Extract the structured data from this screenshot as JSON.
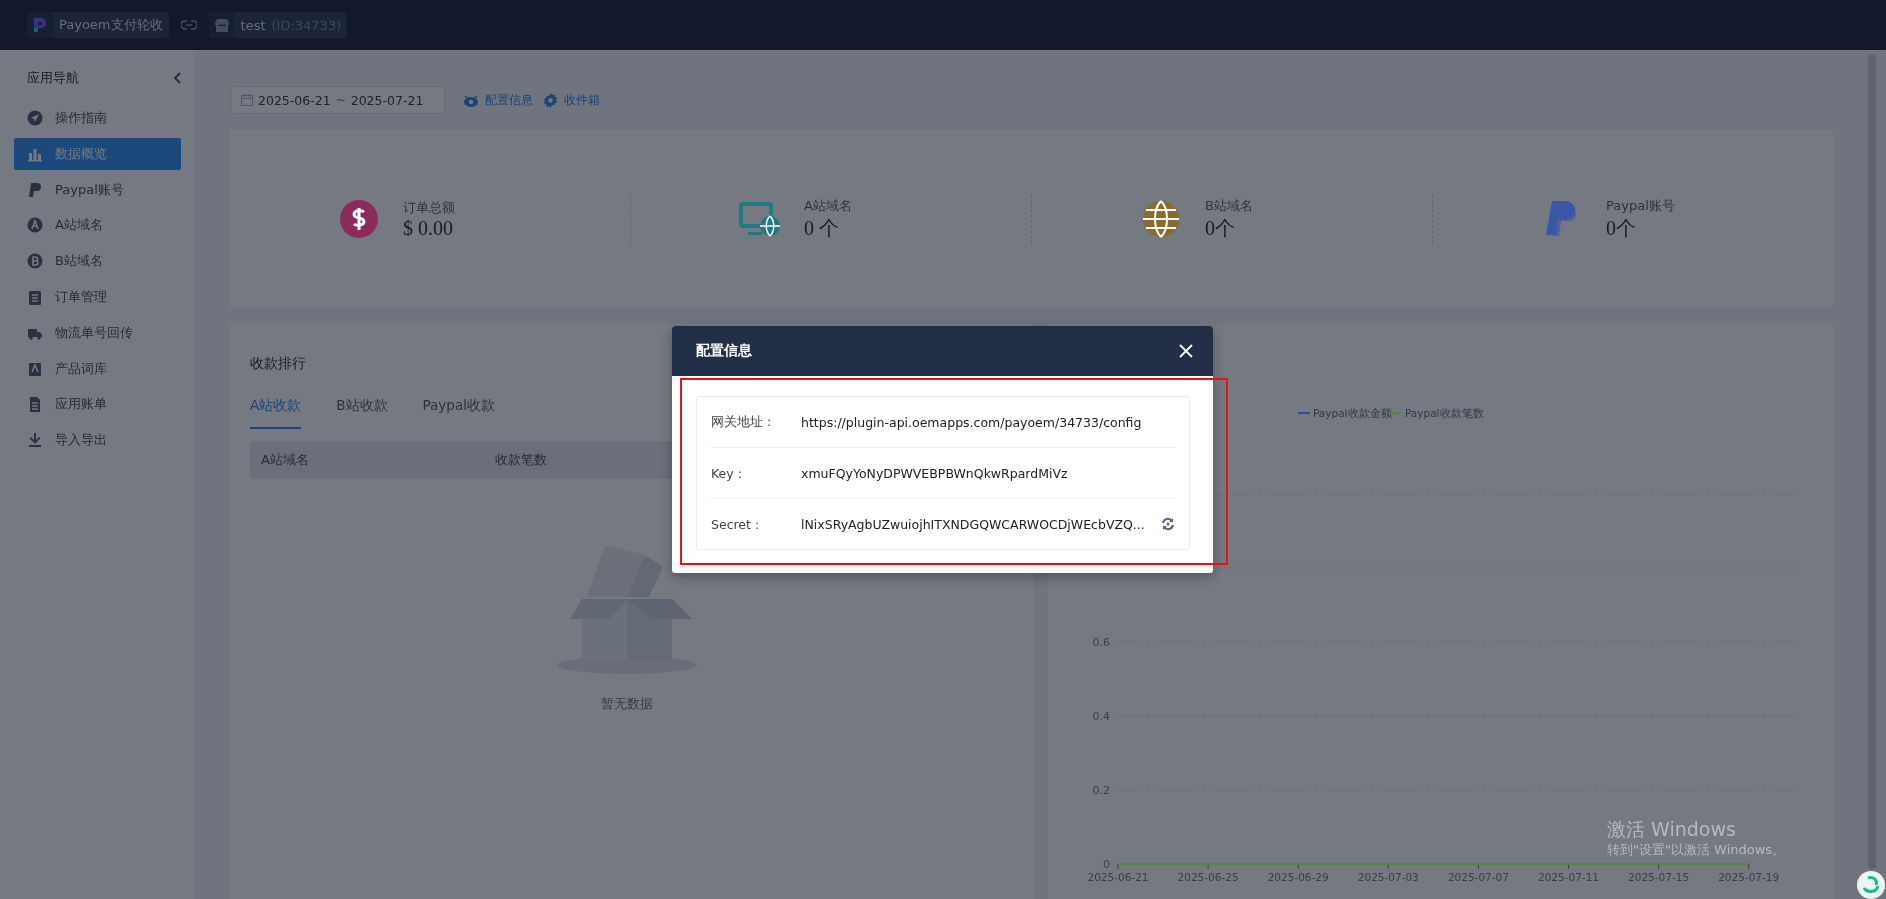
{
  "topbar": {
    "app_name": "Payoem支付轮收",
    "store_name": "test",
    "store_id": "(ID:34733)"
  },
  "sidebar": {
    "title": "应用导航",
    "items": [
      {
        "label": "操作指南",
        "selected": false
      },
      {
        "label": "数据概览",
        "selected": true
      },
      {
        "label": "Paypal账号",
        "selected": false
      },
      {
        "label": "A站域名",
        "selected": false
      },
      {
        "label": "B站域名",
        "selected": false
      },
      {
        "label": "订单管理",
        "selected": false
      },
      {
        "label": "物流单号回传",
        "selected": false
      },
      {
        "label": "产品词库",
        "selected": false
      },
      {
        "label": "应用账单",
        "selected": false
      },
      {
        "label": "导入导出",
        "selected": false
      }
    ]
  },
  "toolbar": {
    "date_start": "2025-06-21",
    "date_separator": "~",
    "date_end": "2025-07-21",
    "links": [
      "配置信息",
      "收件箱"
    ]
  },
  "stats": [
    {
      "label": "订单总额",
      "value": "$ 0.00",
      "color": "#8c2a5c"
    },
    {
      "label": "A站域名",
      "value": "0 个",
      "color": "#1f7b80"
    },
    {
      "label": "B站域名",
      "value": "0个",
      "color": "#8d6b2b"
    },
    {
      "label": "Paypal账号",
      "value": "0个",
      "color": "#3a57a6"
    }
  ],
  "ranking": {
    "title": "收款排行",
    "tabs": [
      {
        "label": "A站收款",
        "selected": true
      },
      {
        "label": "B站收款",
        "selected": false
      },
      {
        "label": "Paypal收款",
        "selected": false
      }
    ],
    "table": {
      "columns": [
        "A站域名",
        "收款笔数"
      ]
    },
    "empty_text": "暂无数据"
  },
  "chart_data": {
    "type": "line",
    "categories": [
      "2025-06-21",
      "2025-06-25",
      "2025-06-29",
      "2025-07-03",
      "2025-07-07",
      "2025-07-11",
      "2025-07-15",
      "2025-07-19"
    ],
    "series": [
      {
        "name": "Paypal收款金额",
        "color": "#2d4f9e",
        "values": [
          null,
          null,
          null,
          null,
          null,
          null,
          null,
          null
        ]
      },
      {
        "name": "Paypal收款笔数",
        "color": "#4f8a3c",
        "values": [
          0,
          0,
          0,
          0,
          0,
          0,
          0,
          0
        ]
      }
    ],
    "ylim": [
      0,
      1
    ],
    "yticks": [
      0,
      0.2,
      0.4,
      0.6
    ],
    "grid": true,
    "legend": true
  },
  "modal": {
    "title": "配置信息",
    "rows": [
      {
        "label": "网关地址 :",
        "value": "https://plugin-api.oemapps.com/payoem/34733/config"
      },
      {
        "label": "Key :",
        "value": "xmuFQyYoNyDPWVEBPBWnQkwRpardMiVz"
      },
      {
        "label": "Secret :",
        "value": "lNixSRyAgbUZwuiojhITXNDGQWCARWOCDjWEcbVZQ..."
      }
    ]
  },
  "activation_notice": {
    "title": "激活 Windows",
    "subtitle": "转到\"设置\"以激活 Windows。"
  }
}
